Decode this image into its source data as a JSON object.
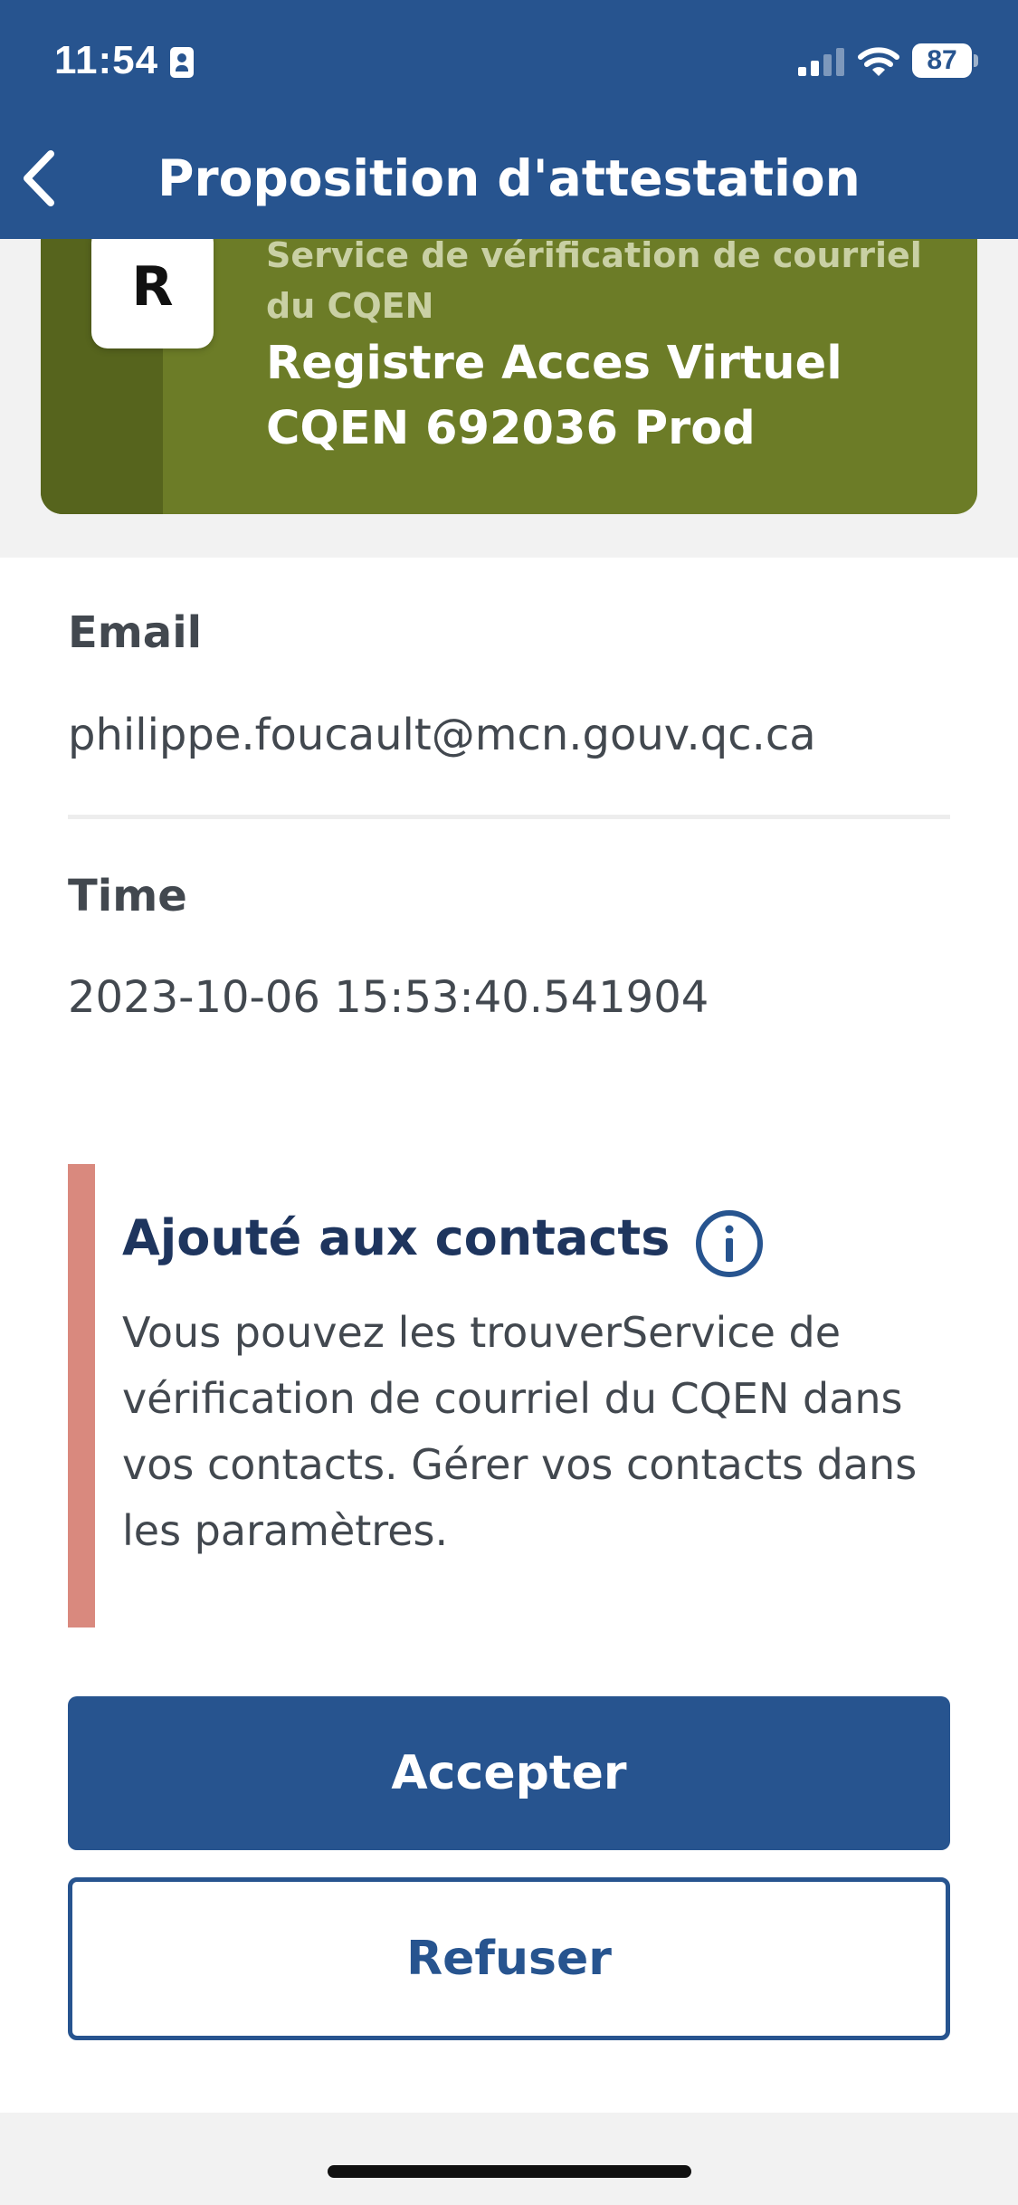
{
  "status_bar": {
    "time": "11:54",
    "battery": "87"
  },
  "header": {
    "title": "Proposition d'attestation"
  },
  "credential_card": {
    "logo_letter": "R",
    "issuer": "Service de vérification de courriel du CQEN",
    "name": "Registre Acces Virtuel CQEN 692036 Prod",
    "colors": {
      "card": "#6c7c27",
      "strip": "#56641d"
    }
  },
  "fields": [
    {
      "label": "Email",
      "value": "philippe.foucault@mcn.gouv.qc.ca"
    },
    {
      "label": "Time",
      "value": "2023-10-06 15:53:40.541904"
    }
  ],
  "notice": {
    "title": "Ajouté aux contacts",
    "body": "Vous pouvez les trouverService de vérification de courriel du CQEN dans vos contacts. Gérer vos contacts dans les paramètres.",
    "accent_color": "#d9897e"
  },
  "actions": {
    "accept_label": "Accepter",
    "refuse_label": "Refuser"
  },
  "theme": {
    "primary": "#27548f",
    "title_dark": "#1e355e"
  }
}
